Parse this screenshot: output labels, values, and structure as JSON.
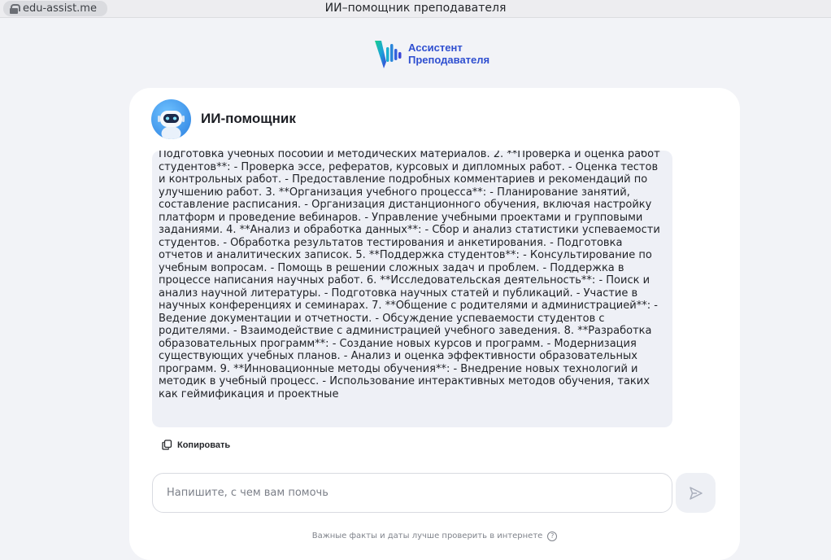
{
  "browser": {
    "url": "edu-assist.me",
    "window_title": "ИИ–помощник преподавателя"
  },
  "logo": {
    "line1": "Ассистент",
    "line2": "Преподавателя"
  },
  "chat": {
    "title": "ИИ-помощник",
    "message": "Подготовка учебных пособий и методических материалов. 2. **Проверка и оценка работ студентов**: - Проверка эссе, рефератов, курсовых и дипломных работ. - Оценка тестов и контрольных работ. - Предоставление подробных комментариев и рекомендаций по улучшению работ. 3. **Организация учебного процесса**: - Планирование занятий, составление расписания. - Организация дистанционного обучения, включая настройку платформ и проведение вебинаров. - Управление учебными проектами и групповыми заданиями. 4. **Анализ и обработка данных**: - Сбор и анализ статистики успеваемости студентов. - Обработка результатов тестирования и анкетирования. - Подготовка отчетов и аналитических записок. 5. **Поддержка студентов**: - Консультирование по учебным вопросам. - Помощь в решении сложных задач и проблем. - Поддержка в процессе написания научных работ. 6. **Исследовательская деятельность**: - Поиск и анализ научной литературы. - Подготовка научных статей и публикаций. - Участие в научных конференциях и семинарах. 7. **Общение с родителями и администрацией**: - Ведение документации и отчетности. - Обсуждение успеваемости студентов с родителями. - Взаимодействие с администрацией учебного заведения. 8. **Разработка образовательных программ**: - Создание новых курсов и программ. - Модернизация существующих учебных планов. - Анализ и оценка эффективности образовательных программ. 9. **Инновационные методы обучения**: - Внедрение новых технологий и методик в учебный процесс. - Использование интерактивных методов обучения, таких как геймификация и проектные",
    "copy_label": "Копировать",
    "input_placeholder": "Напишите, с чем вам помочь",
    "disclaimer": "Важные факты и даты лучше проверить в интернете"
  },
  "colors": {
    "accent": "#2f4fd0",
    "message_bg": "#eef0f6",
    "page_bg": "#f2f3f7"
  }
}
